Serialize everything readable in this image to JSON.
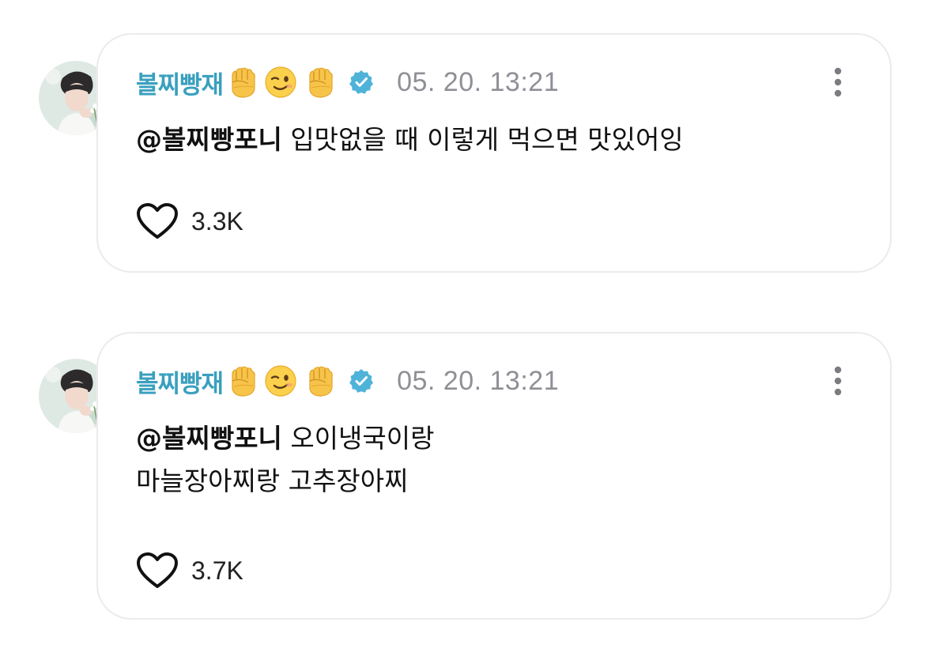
{
  "posts": [
    {
      "author": "볼찌빵재",
      "emojis": [
        "raised-fist-emoji",
        "winking-face-emoji",
        "raised-fist-emoji"
      ],
      "verified_icon": "verified-badge-icon",
      "timestamp": "05. 20. 13:21",
      "mention": "@볼찌빵포니",
      "text_line1": "입맛없을 때 이렇게 먹으면 맛있어잉",
      "text_line2": "",
      "likes": "3.3K"
    },
    {
      "author": "볼찌빵재",
      "emojis": [
        "raised-fist-emoji",
        "winking-face-emoji",
        "raised-fist-emoji"
      ],
      "verified_icon": "verified-badge-icon",
      "timestamp": "05. 20. 13:21",
      "mention": "@볼찌빵포니",
      "text_line1": "오이냉국이랑",
      "text_line2": "마늘장아찌랑 고추장아찌",
      "likes": "3.7K"
    }
  ],
  "colors": {
    "author": "#3aa0bf",
    "verified": "#4fb3d9",
    "timestamp": "#8f8f96",
    "card_border": "#ebebef"
  }
}
